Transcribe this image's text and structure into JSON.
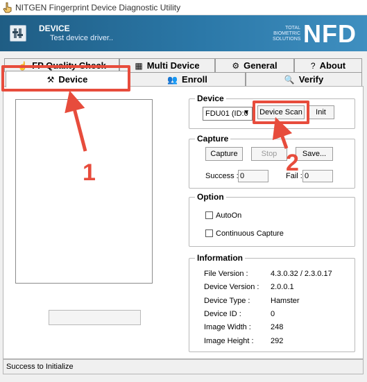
{
  "window": {
    "title": "NITGEN Fingerprint Device Diagnostic Utility",
    "app_icon": "hand-pointer-icon"
  },
  "header": {
    "title": "DEVICE",
    "subtitle": "Test device driver..",
    "brand_small": "TOTAL BIOMETRIC SOLUTIONS",
    "brand_big": "NFD"
  },
  "tabs": {
    "fp_quality": {
      "label": "FP Quality Check",
      "icon": "fingerprint-icon"
    },
    "multi_device": {
      "label": "Multi Device",
      "icon": "multi-device-icon"
    },
    "general": {
      "label": "General",
      "icon": "gear-icon"
    },
    "about": {
      "label": "About",
      "icon": "help-icon"
    },
    "device": {
      "label": "Device",
      "icon": "device-icon"
    },
    "enroll": {
      "label": "Enroll",
      "icon": "users-icon"
    },
    "verify": {
      "label": "Verify",
      "icon": "search-icon"
    }
  },
  "device_group": {
    "title": "Device",
    "selected": "FDU01 (ID:0",
    "scan_label": "Device Scan",
    "init_label": "Init"
  },
  "capture_group": {
    "title": "Capture",
    "capture_label": "Capture",
    "stop_label": "Stop",
    "save_label": "Save...",
    "success_label": "Success :",
    "success_value": "0",
    "fail_label": "Fail :",
    "fail_value": "0"
  },
  "option_group": {
    "title": "Option",
    "auto_on": "AutoOn",
    "continuous": "Continuous Capture"
  },
  "info_group": {
    "title": "Information",
    "rows": [
      {
        "label": "File Version :",
        "value": "4.3.0.32 / 2.3.0.17"
      },
      {
        "label": "Device Version :",
        "value": "2.0.0.1"
      },
      {
        "label": "Device Type :",
        "value": "Hamster"
      },
      {
        "label": "Device ID :",
        "value": "0"
      },
      {
        "label": "Image Width :",
        "value": "248"
      },
      {
        "label": "Image Height :",
        "value": "292"
      }
    ]
  },
  "status": {
    "text": "Success to Initialize"
  },
  "annotations": {
    "one": "1",
    "two": "2",
    "color": "#e74c3c"
  }
}
